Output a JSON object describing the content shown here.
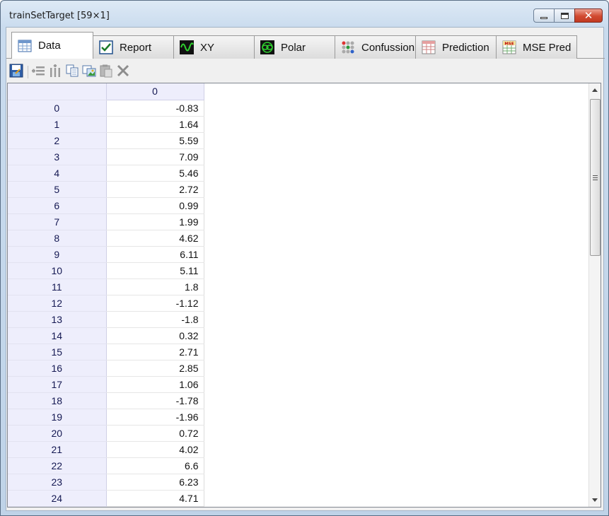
{
  "window": {
    "title": "trainSetTarget [59×1]",
    "controls": {
      "minimize": "minimize",
      "maximize": "maximize",
      "close": "close"
    }
  },
  "tabs": [
    {
      "label": "Data",
      "icon": "grid-icon",
      "active": true
    },
    {
      "label": "Report",
      "icon": "checkbox-icon",
      "active": false
    },
    {
      "label": "XY",
      "icon": "xy-plot-icon",
      "active": false
    },
    {
      "label": "Polar",
      "icon": "polar-plot-icon",
      "active": false
    },
    {
      "label": "Confussion",
      "icon": "confusion-matrix-icon",
      "active": false
    },
    {
      "label": "Prediction",
      "icon": "prediction-grid-icon",
      "active": false
    },
    {
      "label": "MSE Pred",
      "icon": "mse-icon",
      "active": false
    }
  ],
  "toolbar": [
    "save-icon",
    "insert-row-icon",
    "insert-column-icon",
    "copy-icon",
    "export-image-icon",
    "paste-icon",
    "delete-icon"
  ],
  "grid": {
    "column_header": "0",
    "rows": [
      [
        "0",
        "-0.83"
      ],
      [
        "1",
        "1.64"
      ],
      [
        "2",
        "5.59"
      ],
      [
        "3",
        "7.09"
      ],
      [
        "4",
        "5.46"
      ],
      [
        "5",
        "2.72"
      ],
      [
        "6",
        "0.99"
      ],
      [
        "7",
        "1.99"
      ],
      [
        "8",
        "4.62"
      ],
      [
        "9",
        "6.11"
      ],
      [
        "10",
        "5.11"
      ],
      [
        "11",
        "1.8"
      ],
      [
        "12",
        "-1.12"
      ],
      [
        "13",
        "-1.8"
      ],
      [
        "14",
        "0.32"
      ],
      [
        "15",
        "2.71"
      ],
      [
        "16",
        "2.85"
      ],
      [
        "17",
        "1.06"
      ],
      [
        "18",
        "-1.78"
      ],
      [
        "19",
        "-1.96"
      ],
      [
        "20",
        "0.72"
      ],
      [
        "21",
        "4.02"
      ],
      [
        "22",
        "6.6"
      ],
      [
        "23",
        "6.23"
      ],
      [
        "24",
        "4.71"
      ]
    ]
  }
}
